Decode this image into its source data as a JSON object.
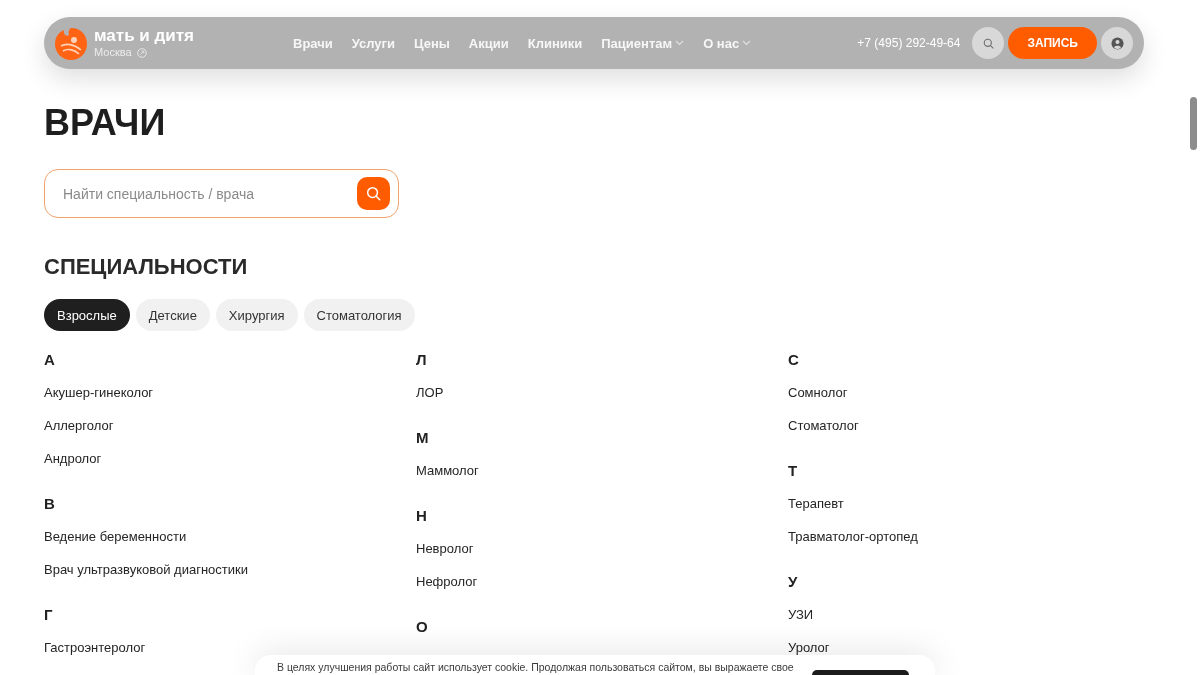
{
  "header": {
    "logo": {
      "name": "мать и дитя",
      "city": "Москва"
    },
    "nav": [
      {
        "label": "Врачи",
        "has_dropdown": false
      },
      {
        "label": "Услуги",
        "has_dropdown": false
      },
      {
        "label": "Цены",
        "has_dropdown": false
      },
      {
        "label": "Акции",
        "has_dropdown": false
      },
      {
        "label": "Клиники",
        "has_dropdown": false
      },
      {
        "label": "Пациентам",
        "has_dropdown": true
      },
      {
        "label": "О нас",
        "has_dropdown": true
      }
    ],
    "phone": "+7 (495) 292-49-64",
    "appointment_button": "ЗАПИСЬ"
  },
  "page_title": "ВРАЧИ",
  "search": {
    "placeholder": "Найти специальность / врача"
  },
  "section_title": "СПЕЦИАЛЬНОСТИ",
  "tabs": [
    {
      "label": "Взрослые",
      "selected": true
    },
    {
      "label": "Детские",
      "selected": false
    },
    {
      "label": "Хирургия",
      "selected": false
    },
    {
      "label": "Стоматология",
      "selected": false
    }
  ],
  "columns": [
    [
      {
        "letter": "А",
        "items": [
          "Акушер-гинеколог",
          "Аллерголог",
          "Андролог"
        ]
      },
      {
        "letter": "В",
        "items": [
          "Ведение беременности",
          "Врач ультразвуковой диагностики"
        ]
      },
      {
        "letter": "Г",
        "items": [
          "Гастроэнтеролог"
        ]
      }
    ],
    [
      {
        "letter": "Л",
        "items": [
          "ЛОР"
        ]
      },
      {
        "letter": "М",
        "items": [
          "Маммолог"
        ]
      },
      {
        "letter": "Н",
        "items": [
          "Невролог",
          "Нефролог"
        ]
      },
      {
        "letter": "О"
      }
    ],
    [
      {
        "letter": "С",
        "items": [
          "Сомнолог",
          "Стоматолог"
        ]
      },
      {
        "letter": "Т",
        "items": [
          "Терапевт",
          "Травматолог-ортопед"
        ]
      },
      {
        "letter": "У",
        "items": [
          "УЗИ",
          "Уролог"
        ]
      }
    ]
  ],
  "cookie_banner": {
    "text": "В целях улучшения работы сайт использует cookie. Продолжая пользоваться сайтом, вы выражаете свое"
  }
}
